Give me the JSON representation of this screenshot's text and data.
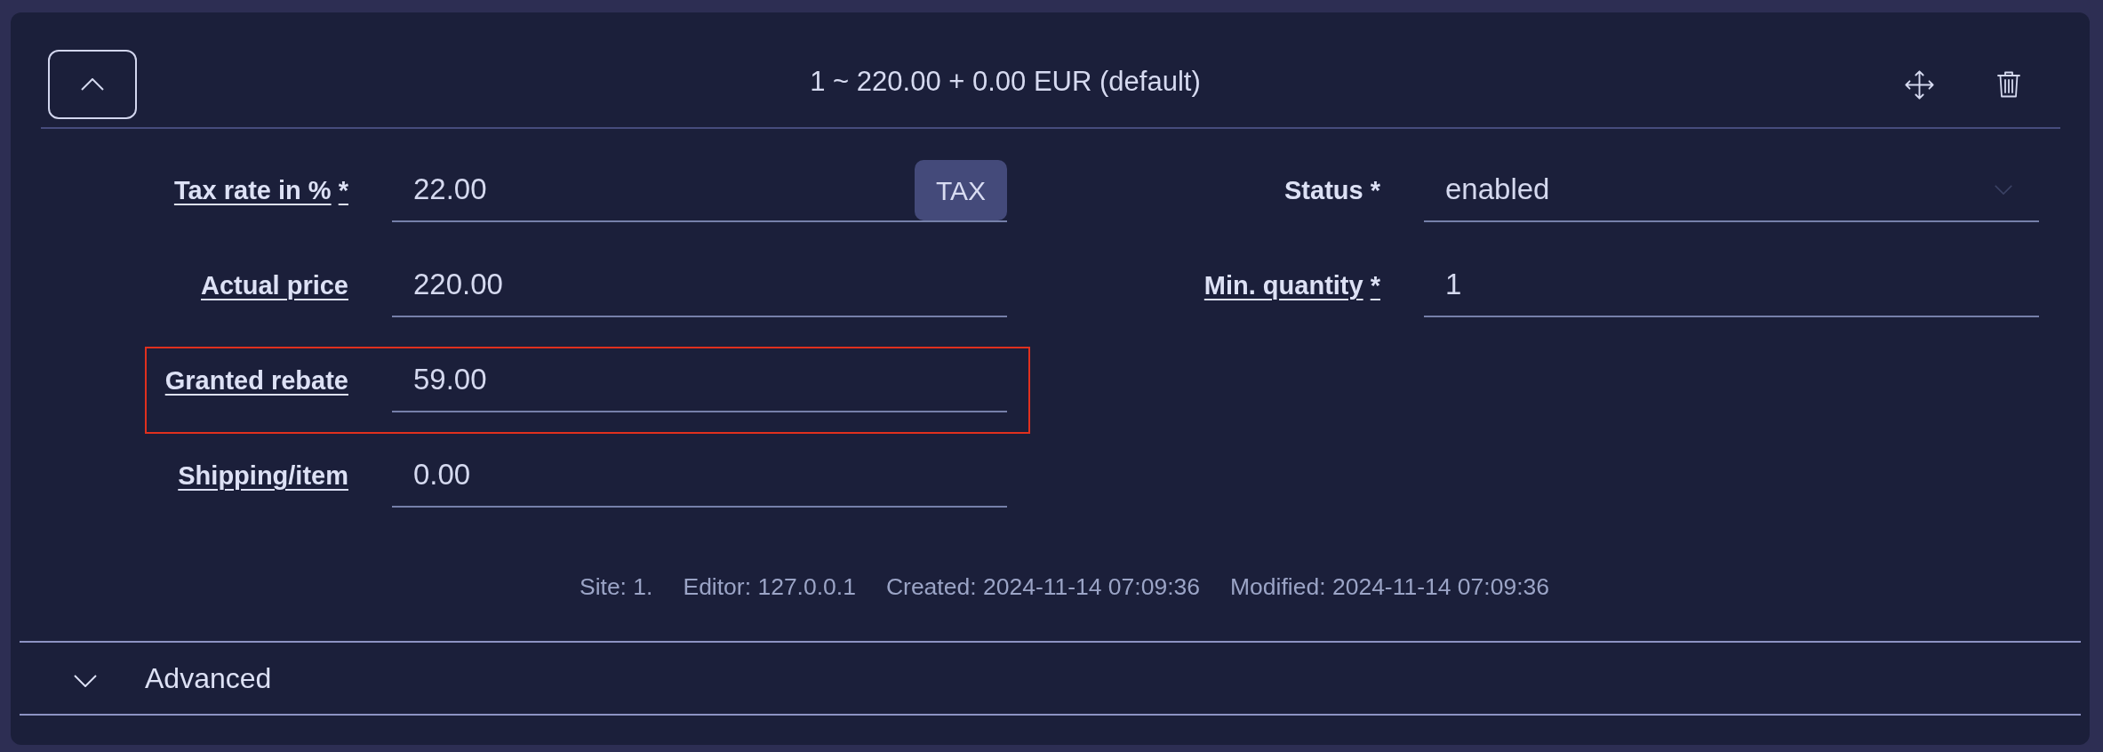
{
  "header": {
    "expanded": true,
    "title": "1 ~ 220.00 + 0.00 EUR (default)"
  },
  "columns": [
    {
      "fields": [
        {
          "kind": "input",
          "label": "Tax rate in %",
          "underlined": true,
          "required_mark": "*",
          "value": "22.00",
          "button": "TAX",
          "highlighted": false
        },
        {
          "kind": "input",
          "label": "Actual price",
          "underlined": true,
          "value": "220.00",
          "highlighted": false
        },
        {
          "kind": "input",
          "label": "Granted rebate",
          "underlined": true,
          "value": "59.00",
          "highlighted": true
        },
        {
          "kind": "input",
          "label": "Shipping/item",
          "underlined": true,
          "value": "0.00",
          "highlighted": false
        }
      ]
    },
    {
      "fields": [
        {
          "kind": "select",
          "label": "Status",
          "underlined": false,
          "required_mark": "*",
          "value": "enabled",
          "highlighted": false
        },
        {
          "kind": "input",
          "label": "Min. quantity",
          "underlined": true,
          "required_mark": "*",
          "value": "1",
          "highlighted": false
        }
      ]
    }
  ],
  "meta": [
    "Site: 1.",
    "Editor: 127.0.0.1",
    "Created: 2024-11-14 07:09:36",
    "Modified: 2024-11-14 07:09:36"
  ],
  "sections": [
    {
      "label": "Advanced",
      "expanded": false
    }
  ]
}
